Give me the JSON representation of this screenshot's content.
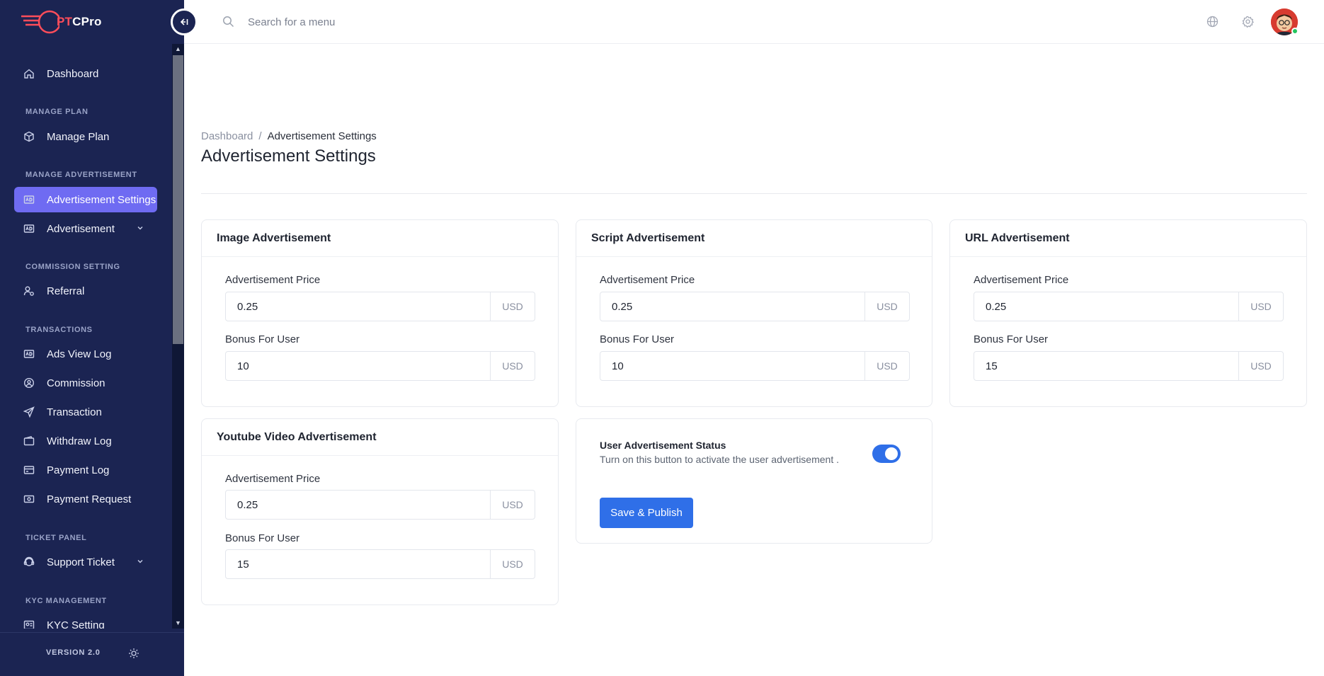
{
  "app": {
    "logo_text_accent": "PT",
    "logo_text_rest": "CPro",
    "version": "VERSION 2.0"
  },
  "colors": {
    "sidebar_bg": "#1b2452",
    "active_item": "#6f6bf2",
    "primary": "#2f6fe8",
    "online": "#22c55e"
  },
  "sidebar": {
    "items": {
      "dashboard": "Dashboard",
      "manage_plan": "Manage Plan",
      "advertisement_settings": "Advertisement Settings",
      "advertisement": "Advertisement",
      "referral": "Referral",
      "ads_view_log": "Ads View Log",
      "commission": "Commission",
      "transaction": "Transaction",
      "withdraw_log": "Withdraw Log",
      "payment_log": "Payment Log",
      "payment_request": "Payment Request",
      "support_ticket": "Support Ticket",
      "kyc_setting": "KYC Setting"
    },
    "sections": {
      "manage_plan": "MANAGE PLAN",
      "manage_advertisement": "MANAGE ADVERTISEMENT",
      "commission_setting": "COMMISSION SETTING",
      "transactions": "TRANSACTIONS",
      "ticket_panel": "TICKET PANEL",
      "kyc_management": "KYC MANAGEMENT"
    },
    "active": "Advertisement Settings"
  },
  "topbar": {
    "search_placeholder": "Search for a menu"
  },
  "page": {
    "breadcrumb_home": "Dashboard",
    "breadcrumb_sep": "/",
    "breadcrumb_current": "Advertisement Settings",
    "title": "Advertisement Settings"
  },
  "cards": {
    "image": {
      "title": "Image Advertisement",
      "price_label": "Advertisement Price",
      "price": "0.25",
      "bonus_label": "Bonus For User",
      "bonus": "10",
      "currency": "USD"
    },
    "script": {
      "title": "Script Advertisement",
      "price_label": "Advertisement Price",
      "price": "0.25",
      "bonus_label": "Bonus For User",
      "bonus": "10",
      "currency": "USD"
    },
    "url": {
      "title": "URL Advertisement",
      "price_label": "Advertisement Price",
      "price": "0.25",
      "bonus_label": "Bonus For User",
      "bonus": "15",
      "currency": "USD"
    },
    "youtube": {
      "title": "Youtube Video Advertisement",
      "price_label": "Advertisement Price",
      "price": "0.25",
      "bonus_label": "Bonus For User",
      "bonus": "15",
      "currency": "USD"
    }
  },
  "status_card": {
    "title": "User Advertisement Status",
    "description": "Turn on this button to activate the user advertisement .",
    "enabled": true,
    "save_label": "Save & Publish"
  }
}
